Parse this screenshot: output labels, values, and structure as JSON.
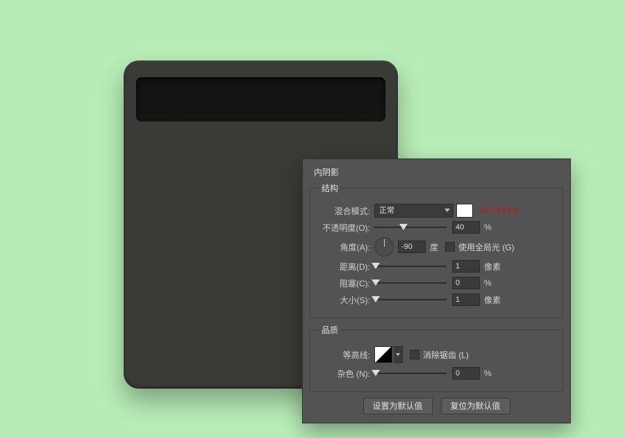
{
  "panel": {
    "title": "内阴影",
    "structure_legend": "结构",
    "quality_legend": "品质",
    "blend_mode_label": "混合模式:",
    "blend_mode_value": "正常",
    "color_swatch": "#FFFFFF",
    "hex_callout": "#FFFFFF",
    "opacity_label": "不透明度(O):",
    "opacity_value": "40",
    "opacity_unit": "%",
    "angle_label": "角度(A):",
    "angle_value": "-90",
    "angle_unit": "度",
    "global_light_label": "使用全局光 (G)",
    "distance_label": "距离(D):",
    "distance_value": "1",
    "distance_unit": "像素",
    "choke_label": "阻塞(C):",
    "choke_value": "0",
    "choke_unit": "%",
    "size_label": "大小(S):",
    "size_value": "1",
    "size_unit": "像素",
    "contour_label": "等高线:",
    "antialias_label": "消除锯齿 (L)",
    "noise_label": "杂色 (N):",
    "noise_value": "0",
    "noise_unit": "%",
    "make_default_btn": "设置为默认值",
    "reset_default_btn": "复位为默认值"
  },
  "sliders": {
    "opacity_pct": 40,
    "distance_pct": 2,
    "choke_pct": 2,
    "size_pct": 2,
    "noise_pct": 2
  }
}
